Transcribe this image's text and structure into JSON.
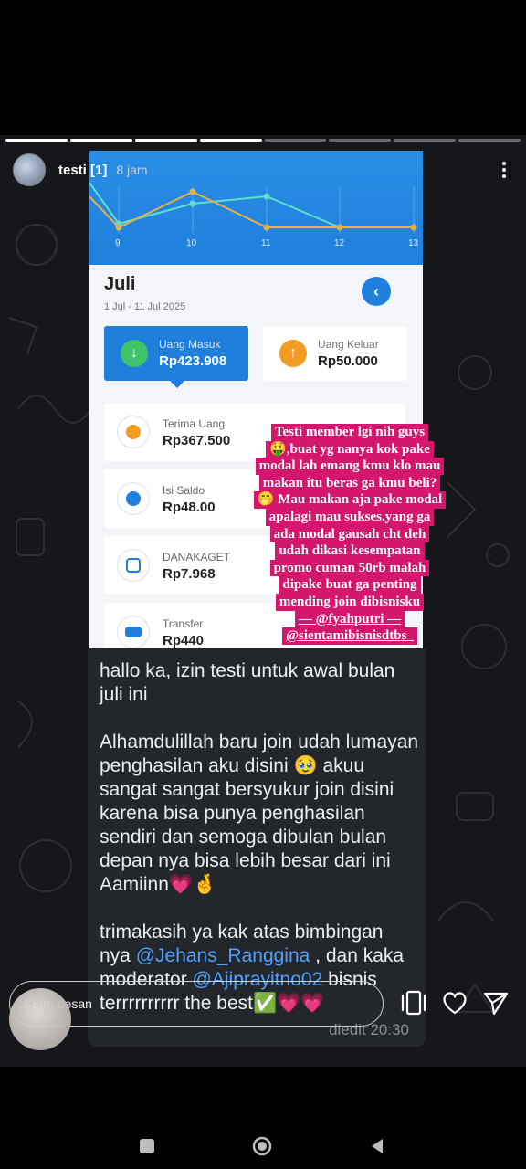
{
  "story": {
    "username": "testi",
    "badge": "[1]",
    "time": "8 jam",
    "progress_total": 8,
    "progress_done": 1
  },
  "app": {
    "chart_ticks": [
      "9",
      "10",
      "11",
      "12",
      "13"
    ],
    "month": "Juli",
    "range": "1 Jul - 11 Jul 2025",
    "uang_masuk": {
      "label": "Uang Masuk",
      "amount": "Rp423.908"
    },
    "uang_keluar": {
      "label": "Uang Keluar",
      "amount": "Rp50.000"
    },
    "rows": [
      {
        "label": "Terima Uang",
        "amount": "Rp367.500",
        "icon": "hand-money-icon",
        "color": "#f39c23"
      },
      {
        "label": "Isi Saldo",
        "amount": "Rp48.00",
        "icon": "plus-circle-icon",
        "color": "#1f7fdc"
      },
      {
        "label": "DANAKAGET",
        "amount": "Rp7.968",
        "icon": "phone-gift-icon",
        "color": "#1f7fdc"
      },
      {
        "label": "Transfer",
        "amount": "Rp440",
        "icon": "transfer-icon",
        "color": "#1f7fdc"
      }
    ]
  },
  "caption": {
    "lines": [
      "Testi member lgi nih guys",
      "🤑,buat yg nanya kok pake",
      "modal lah emang kmu klo mau",
      "makan itu beras ga kmu beli?",
      "🤭 Mau makan aja pake modal",
      "apalagi mau sukses.yang ga",
      "ada modal gausah cht deh",
      "udah dikasi kesempatan",
      "promo cuman 50rb malah",
      "dipake buat ga penting",
      "mending join dibisnisku"
    ],
    "tag1": "— @fyahputri —",
    "tag2": "@sientamibisnisdtbs_"
  },
  "chat": {
    "p1": "hallo ka, izin testi untuk awal bulan juli ini",
    "p2": "Alhamdulillah baru join udah lumayan penghasilan aku disini 🥹 akuu sangat sangat bersyukur join disini karena bisa punya penghasilan sendiri dan semoga dibulan bulan depan nya bisa lebih besar dari ini Aamiinn💗🤞",
    "p3_a": "trimakasih ya kak atas bimbingan nya ",
    "mention1": "@Jehans_Ranggina",
    "p3_b": " , dan kaka moderator ",
    "mention2": "@Ajiprayitno02",
    "p3_c": " bisnis terrrrrrrrrr the best✅💗💗",
    "edited": "diedit 20:30"
  },
  "reply": {
    "placeholder": "Kirim pesan"
  }
}
